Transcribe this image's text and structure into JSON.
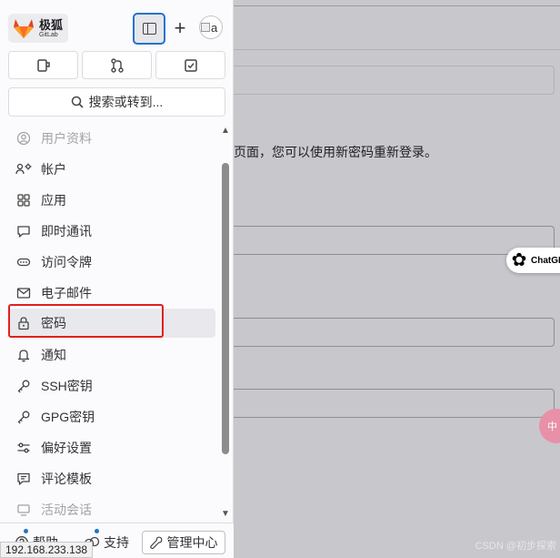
{
  "brand": {
    "name": "极狐",
    "sub": "GitLab"
  },
  "header": {
    "plus_label": "+",
    "avatar_alt": "a"
  },
  "search": {
    "label": "搜索或转到..."
  },
  "nav": {
    "items": [
      {
        "label": "用户资料",
        "icon": "user-icon",
        "state": "faded"
      },
      {
        "label": "帐户",
        "icon": "account-icon",
        "state": "normal"
      },
      {
        "label": "应用",
        "icon": "applications-icon",
        "state": "normal"
      },
      {
        "label": "即时通讯",
        "icon": "chat-icon",
        "state": "normal"
      },
      {
        "label": "访问令牌",
        "icon": "token-icon",
        "state": "normal"
      },
      {
        "label": "电子邮件",
        "icon": "mail-icon",
        "state": "normal"
      },
      {
        "label": "密码",
        "icon": "lock-icon",
        "state": "active"
      },
      {
        "label": "通知",
        "icon": "bell-icon",
        "state": "normal"
      },
      {
        "label": "SSH密钥",
        "icon": "key-icon",
        "state": "normal"
      },
      {
        "label": "GPG密钥",
        "icon": "key-icon",
        "state": "normal"
      },
      {
        "label": "偏好设置",
        "icon": "preferences-icon",
        "state": "normal"
      },
      {
        "label": "评论模板",
        "icon": "comment-template-icon",
        "state": "normal"
      },
      {
        "label": "活动会话",
        "icon": "session-icon",
        "state": "faded"
      }
    ]
  },
  "footer": {
    "help": "帮助",
    "support": "支持",
    "admin": "管理中心"
  },
  "status_url": "192.168.233.138",
  "main": {
    "description": "页面，您可以使用新密码重新登录。",
    "watermark": "CSDN @初步探索"
  },
  "chatgpt_badge": {
    "label": "ChatGP",
    "logo": "✿"
  },
  "pink_bubble": {
    "label": "中"
  },
  "colors": {
    "accent": "#1f75cb",
    "highlight": "#e02020",
    "brand_orange": "#fc6d26"
  }
}
